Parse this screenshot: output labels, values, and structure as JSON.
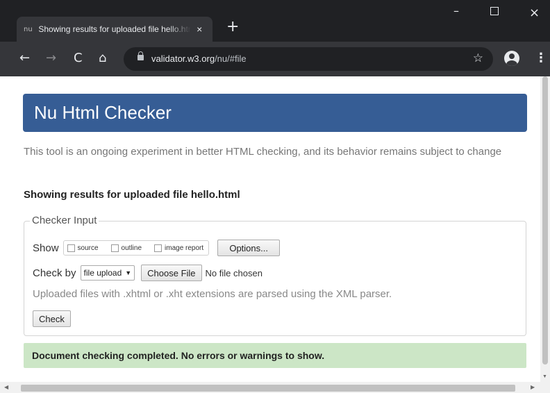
{
  "browser": {
    "tab": {
      "favicon_text": "nu",
      "title": "Showing results for uploaded file hello.html - Nu Html Checker",
      "close_glyph": "×"
    },
    "new_tab_glyph": "+",
    "window_controls": {
      "minimize": "–",
      "close": "×"
    },
    "nav": {
      "back": "←",
      "forward": "→",
      "reload": "C",
      "home": "⌂"
    },
    "address": {
      "host": "validator.w3.org",
      "path": "/nu/#file"
    },
    "bookmark_glyph": "☆",
    "menu_glyph": "⋮",
    "icons": [
      "lock-icon",
      "star-icon",
      "profile-icon",
      "menu-icon"
    ]
  },
  "page": {
    "title": "Nu Html Checker",
    "intro": "This tool is an ongoing experiment in better HTML checking, and its behavior remains subject to change",
    "results_heading": "Showing results for uploaded file hello.html",
    "checker_input": {
      "legend": "Checker Input",
      "show_label": "Show",
      "show_options": [
        {
          "label": "source",
          "checked": false
        },
        {
          "label": "outline",
          "checked": false
        },
        {
          "label": "image report",
          "checked": false
        }
      ],
      "options_button": "Options...",
      "check_by_label": "Check by",
      "check_by_value": "file upload",
      "choose_file_button": "Choose File",
      "no_file_text": "No file chosen",
      "note": "Uploaded files with .xhtml or .xht extensions are parsed using the XML parser.",
      "check_button": "Check"
    },
    "success_message": "Document checking completed. No errors or warnings to show."
  },
  "colors": {
    "banner": "#365d95",
    "success_bg": "#cce6c6",
    "chrome_frame": "#202124",
    "chrome_toolbar": "#35363a"
  }
}
